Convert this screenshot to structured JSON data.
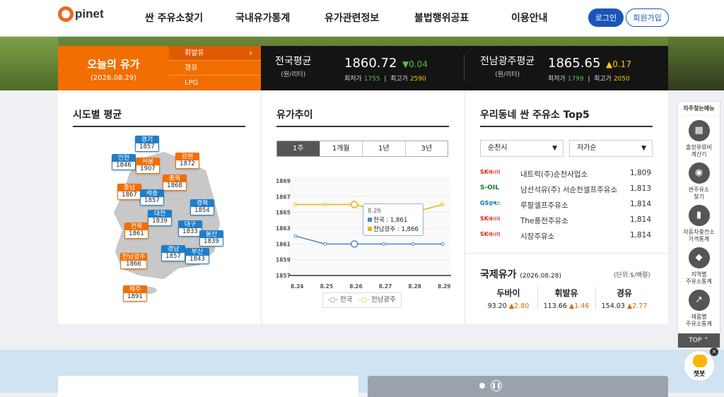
{
  "header": {
    "logo_text": "pinet",
    "nav": [
      "싼 주유소찾기",
      "국내유가통계",
      "유가관련정보",
      "불법행위공표",
      "이용안내"
    ],
    "login": "로그인",
    "join": "회원가입"
  },
  "today": {
    "title": "오늘의 유가",
    "date": "(2026.08.29)",
    "fuel_tabs": [
      "휘발유",
      "경유",
      "LPG"
    ],
    "active_tab": "휘발유"
  },
  "national": {
    "title": "전국평균",
    "unit": "(원/리터)",
    "price": "1860.72",
    "change": "▼0.04",
    "min_label": "최저가",
    "min": "1755",
    "max_label": "최고가",
    "max": "2590"
  },
  "jeonnam": {
    "title": "전남광주평균",
    "unit": "(원/리터)",
    "price": "1865.65",
    "change": "▲0.17",
    "min_label": "최저가",
    "min": "1799",
    "max_label": "최고가",
    "max": "2050"
  },
  "regional": {
    "title": "시도별 평균",
    "regions": [
      {
        "name": "경기",
        "value": "1857",
        "color": "blue"
      },
      {
        "name": "인천",
        "value": "1846",
        "color": "blue"
      },
      {
        "name": "서울",
        "value": "1907",
        "color": "orng"
      },
      {
        "name": "강원",
        "value": "1872",
        "color": "orng"
      },
      {
        "name": "충북",
        "value": "1868",
        "color": "orng"
      },
      {
        "name": "충남",
        "value": "1867",
        "color": "orng"
      },
      {
        "name": "세종",
        "value": "1857",
        "color": "blue"
      },
      {
        "name": "경북",
        "value": "1854",
        "color": "blue"
      },
      {
        "name": "대전",
        "value": "1839",
        "color": "blue"
      },
      {
        "name": "전북",
        "value": "1861",
        "color": "orng"
      },
      {
        "name": "대구",
        "value": "1833",
        "color": "blue"
      },
      {
        "name": "울산",
        "value": "1839",
        "color": "blue"
      },
      {
        "name": "경남",
        "value": "1857",
        "color": "blue"
      },
      {
        "name": "부산",
        "value": "1843",
        "color": "blue"
      },
      {
        "name": "전남광주",
        "value": "1866",
        "color": "orng"
      },
      {
        "name": "제주",
        "value": "1891",
        "color": "orng"
      }
    ]
  },
  "trend": {
    "title": "유가추이",
    "tabs": [
      "1주",
      "1개월",
      "1년",
      "3년"
    ],
    "active_tab": "1주",
    "tooltip": {
      "date": "8.26",
      "line1": "전국 : 1,861",
      "line2": "전남광주 : 1,866"
    },
    "legend": [
      "전국",
      "전남광주"
    ]
  },
  "chart_data": {
    "type": "line",
    "x": [
      "8.24",
      "8.25",
      "8.26",
      "8.27",
      "8.28",
      "8.29"
    ],
    "yticks": [
      1869,
      1867,
      1865,
      1863,
      1861,
      1859,
      1857
    ],
    "ylim": [
      1857,
      1869
    ],
    "series": [
      {
        "name": "전국",
        "color": "#4a86c8",
        "values": [
          1862,
          1861,
          1861,
          1861,
          1861,
          1861
        ]
      },
      {
        "name": "전남광주",
        "color": "#f0b400",
        "values": [
          1866,
          1866,
          1866,
          1865,
          1865,
          1866
        ]
      }
    ]
  },
  "top5": {
    "title": "우리동네 싼 주유소 Top5",
    "select_city": "순천시",
    "select_sort": "저가순",
    "stations": [
      {
        "brand": "SK에너지",
        "name": "내트럭(주)순천사업소",
        "price": "1,809"
      },
      {
        "brand": "S-OIL",
        "name": "남선석유(주) 서순천셀프주유소",
        "price": "1,813"
      },
      {
        "brand": "GS칼텍스",
        "name": "루팔셀프주유소",
        "price": "1,814"
      },
      {
        "brand": "SK에너지",
        "name": "The풍전주유소",
        "price": "1,814"
      },
      {
        "brand": "SK에너지",
        "name": "시장주유소",
        "price": "1,814"
      }
    ]
  },
  "intl": {
    "title": "국제유가",
    "date": "(2026.08.28)",
    "unit": "(단위:$/배럴)",
    "items": [
      {
        "name": "두바이",
        "value": "93.20",
        "change": "▲2.80"
      },
      {
        "name": "휘발유",
        "value": "113.66",
        "change": "▲1.46"
      },
      {
        "name": "경유",
        "value": "154.03",
        "change": "▲2.77"
      }
    ]
  },
  "sidebar": {
    "title": "자주찾는메뉴",
    "items": [
      {
        "label1": "출장유류비",
        "label2": "계산기",
        "icon": "calculator-icon"
      },
      {
        "label1": "싼주유소",
        "label2": "찾기",
        "icon": "location-pin-icon"
      },
      {
        "label1": "자동차충전소",
        "label2": "가격통계",
        "icon": "charger-icon"
      },
      {
        "label1": "지역별",
        "label2": "주유소통계",
        "icon": "map-icon"
      },
      {
        "label1": "제품별",
        "label2": "주유소통계",
        "icon": "chart-icon"
      }
    ],
    "top": "TOP",
    "chatbot": "챗봇"
  }
}
